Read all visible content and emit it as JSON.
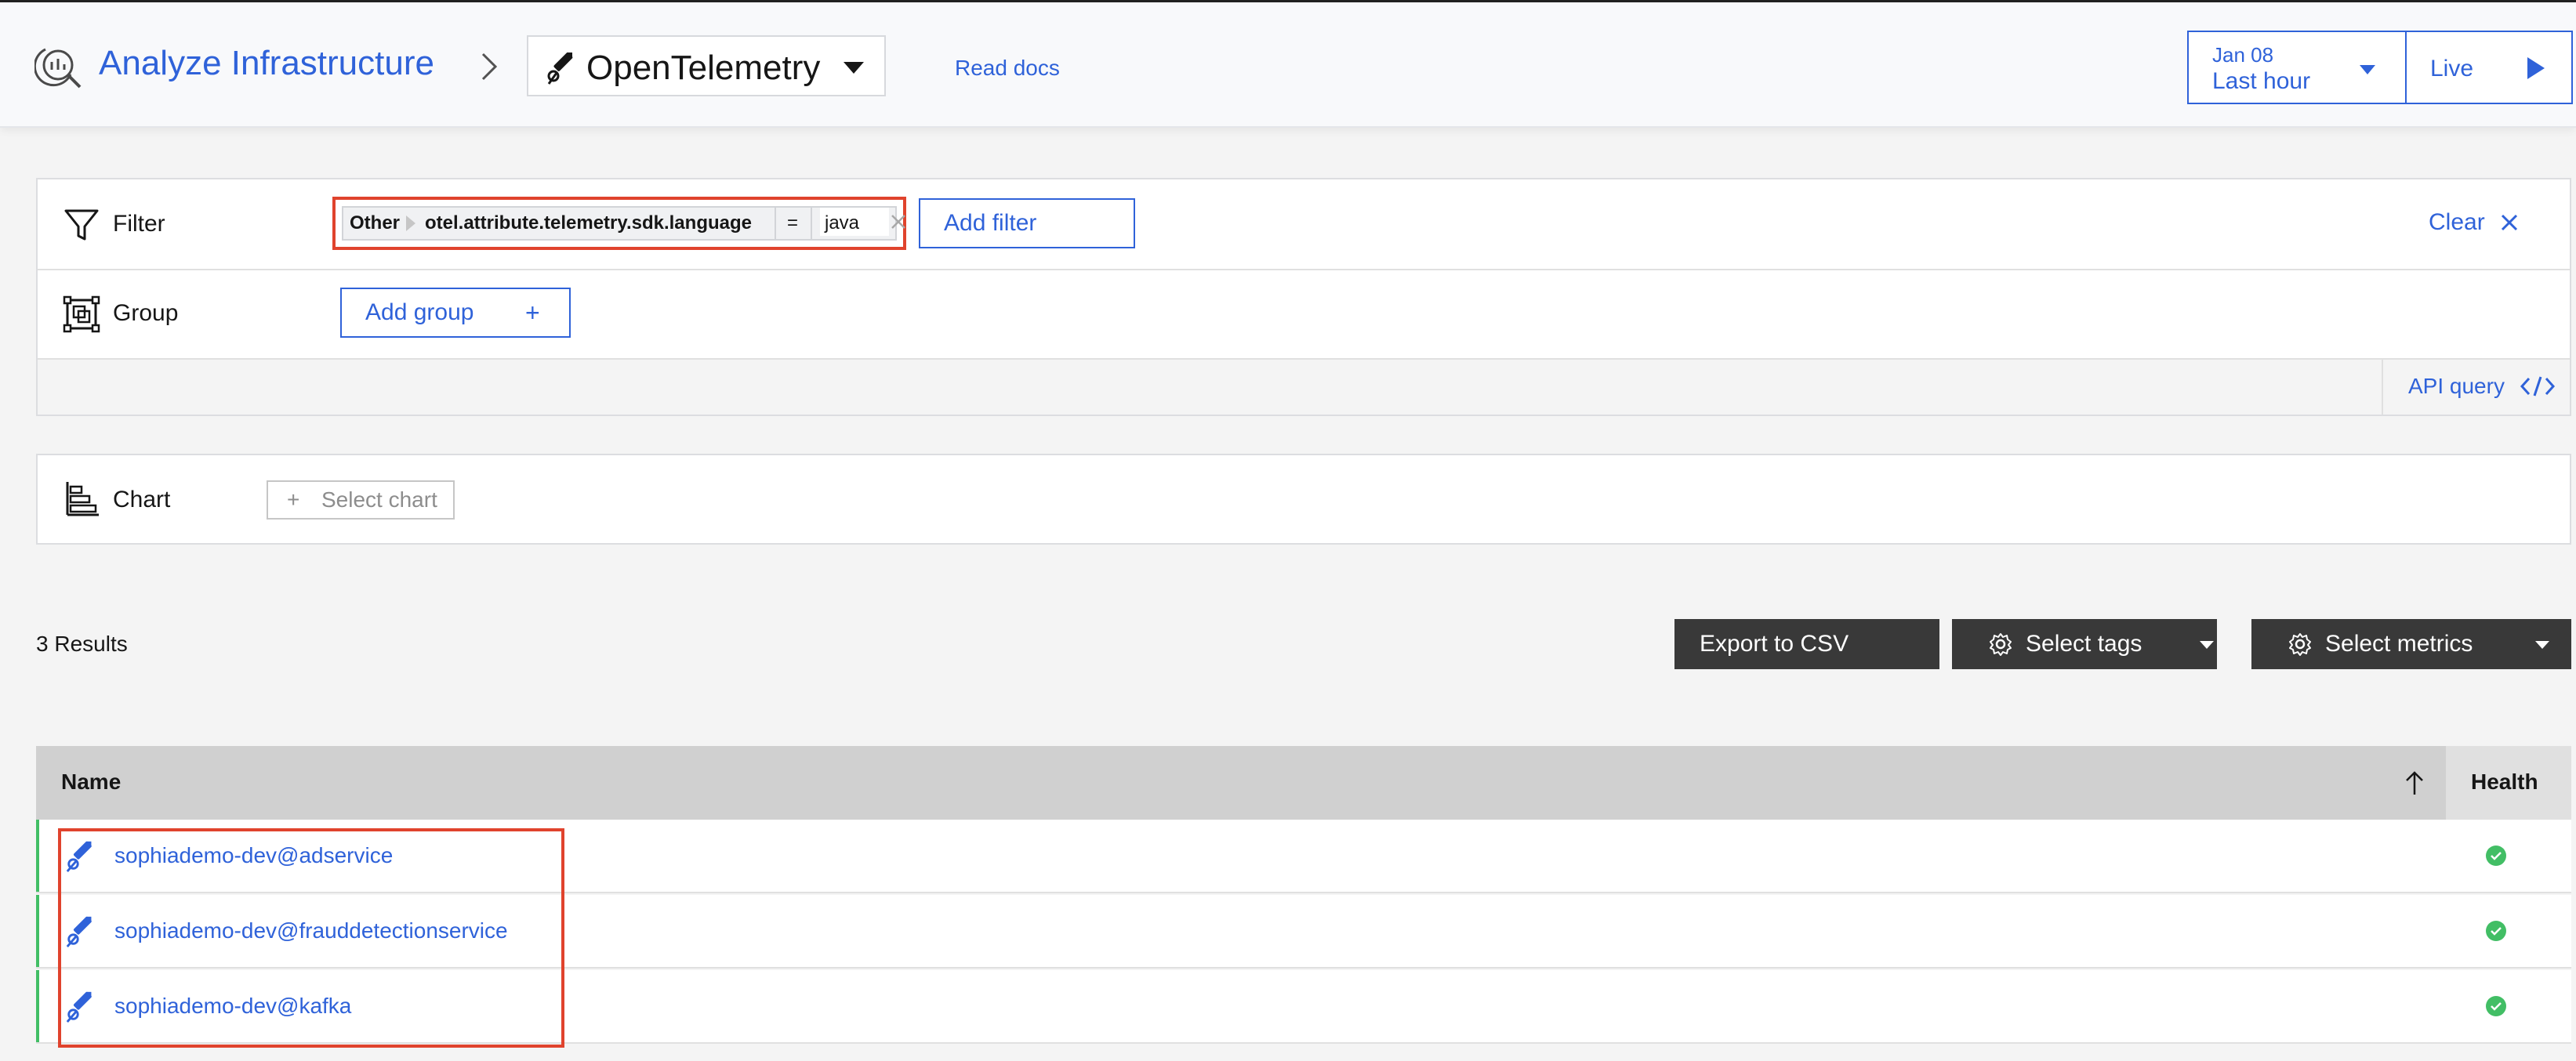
{
  "header": {
    "title": "Analyze Infrastructure",
    "technology": "OpenTelemetry",
    "read_docs": "Read docs",
    "time": {
      "date": "Jan 08",
      "range": "Last hour"
    },
    "live_label": "Live"
  },
  "query": {
    "filter_label": "Filter",
    "filter_chip": {
      "category": "Other",
      "key": "otel.attribute.telemetry.sdk.language",
      "operator": "=",
      "value": "java"
    },
    "add_filter": "Add filter",
    "clear": "Clear",
    "group_label": "Group",
    "add_group": "Add group",
    "add_group_plus": "+",
    "api_query": "API query"
  },
  "chart_panel": {
    "label": "Chart",
    "select_plus": "+",
    "select_chart": "Select chart"
  },
  "results": {
    "count": "3 Results",
    "export": "Export to CSV",
    "select_tags": "Select tags",
    "select_metrics": "Select metrics"
  },
  "table": {
    "columns": {
      "name": "Name",
      "health": "Health"
    },
    "rows": [
      {
        "name": "sophiademo-dev@adservice",
        "health": "healthy"
      },
      {
        "name": "sophiademo-dev@frauddetectionservice",
        "health": "healthy"
      },
      {
        "name": "sophiademo-dev@kafka",
        "health": "healthy"
      }
    ]
  },
  "colors": {
    "accent": "#2f62d9",
    "highlight": "#e0432d",
    "healthy": "#42be65",
    "dark_button": "#393939"
  },
  "icons": {
    "analyze": "analyze-infrastructure-icon",
    "telescope": "opentelemetry-telescope-icon",
    "filter": "funnel-icon",
    "group": "group-icon",
    "chart": "bar-chart-icon",
    "gear": "gear-icon",
    "health": "checkmark-circle-icon"
  }
}
